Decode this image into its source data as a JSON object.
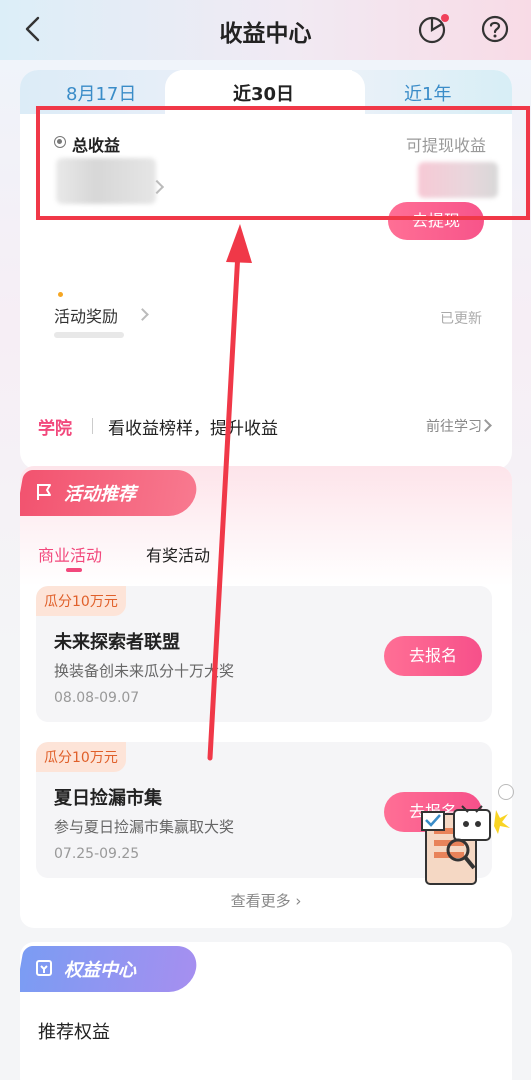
{
  "header": {
    "title": "收益中心",
    "icons": [
      "back-icon",
      "chart-icon",
      "help-icon"
    ]
  },
  "tabs": [
    {
      "label": "8月17日",
      "active": false
    },
    {
      "label": "近30日",
      "active": true
    },
    {
      "label": "近1年",
      "active": false
    }
  ],
  "earnings": {
    "total_label": "总收益",
    "withdrawable_label": "可提现收益",
    "withdraw_button": "去提现"
  },
  "activity_reward": {
    "label": "活动奖励",
    "status": "已更新"
  },
  "college": {
    "tag": "学院",
    "text": "看收益榜样，提升收益",
    "link": "前往学习"
  },
  "activity_section": {
    "title": "活动推荐",
    "sub_tabs": [
      {
        "label": "商业活动",
        "active": true
      },
      {
        "label": "有奖活动",
        "active": false
      }
    ],
    "items": [
      {
        "badge": "瓜分10万元",
        "title": "未来探索者联盟",
        "desc": "换装备创未来瓜分十万大奖",
        "date": "08.08-09.07",
        "button": "去报名"
      },
      {
        "badge": "瓜分10万元",
        "title": "夏日捡漏市集",
        "desc": "参与夏日捡漏市集赢取大奖",
        "date": "07.25-09.25",
        "button": "去报名"
      }
    ],
    "more": "查看更多"
  },
  "rights_section": {
    "title": "权益中心",
    "subtitle": "推荐权益"
  },
  "colors": {
    "accent_pink": "#f2487c",
    "annotation_red": "#f03848",
    "tab_blue": "#3a8cc8"
  }
}
